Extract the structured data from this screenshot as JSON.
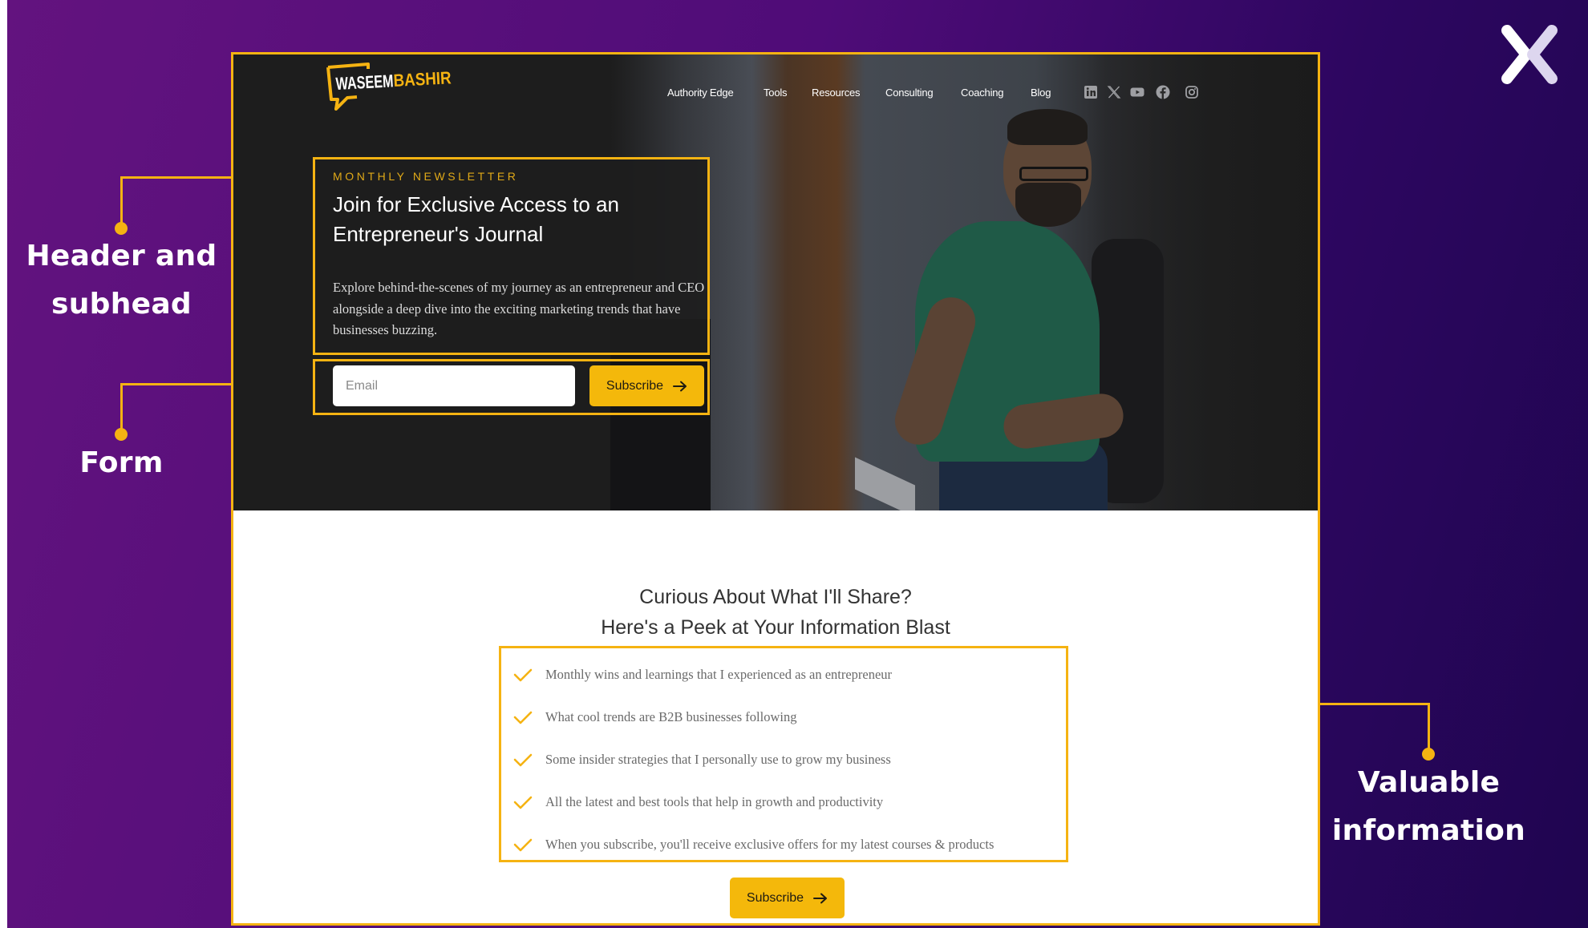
{
  "colors": {
    "accent": "#f5b312",
    "button": "#f4b80b",
    "hero_bg": "#1d1d1d",
    "annotation_text": "#ffffff"
  },
  "brand_mark": {
    "icon": "double-chevron-x-logo"
  },
  "annotations": [
    {
      "id": "header",
      "label_line1": "Header and",
      "label_line2": "subhead"
    },
    {
      "id": "form",
      "label_line1": "Form",
      "label_line2": ""
    },
    {
      "id": "valuable",
      "label_line1": "Valuable",
      "label_line2": "information"
    }
  ],
  "site": {
    "logo": {
      "part1": "WASEEM",
      "part2": "BASHIR"
    },
    "nav": [
      "Authority Edge",
      "Tools",
      "Resources",
      "Consulting",
      "Coaching",
      "Blog"
    ],
    "social": [
      "linkedin-icon",
      "x-twitter-icon",
      "youtube-icon",
      "facebook-icon",
      "instagram-icon"
    ],
    "hero": {
      "eyebrow": "MONTHLY NEWSLETTER",
      "headline": "Join for Exclusive Access to an Entrepreneur's Journal",
      "description": "Explore behind-the-scenes of my journey as an entrepreneur and CEO alongside a deep dive into the exciting marketing trends that have businesses buzzing.",
      "email_placeholder": "Email",
      "email_value": "",
      "subscribe_label": "Subscribe"
    },
    "info": {
      "title_line1": "Curious About What I'll Share?",
      "title_line2": "Here's a Peek at Your Information Blast",
      "benefits": [
        "Monthly wins and learnings that I experienced as an entrepreneur",
        "What cool trends are B2B businesses following",
        "Some insider strategies that I personally use to grow my business",
        "All the latest and best tools that help in growth and productivity",
        "When you subscribe, you'll receive exclusive offers for my latest courses & products"
      ],
      "subscribe_label": "Subscribe"
    }
  }
}
